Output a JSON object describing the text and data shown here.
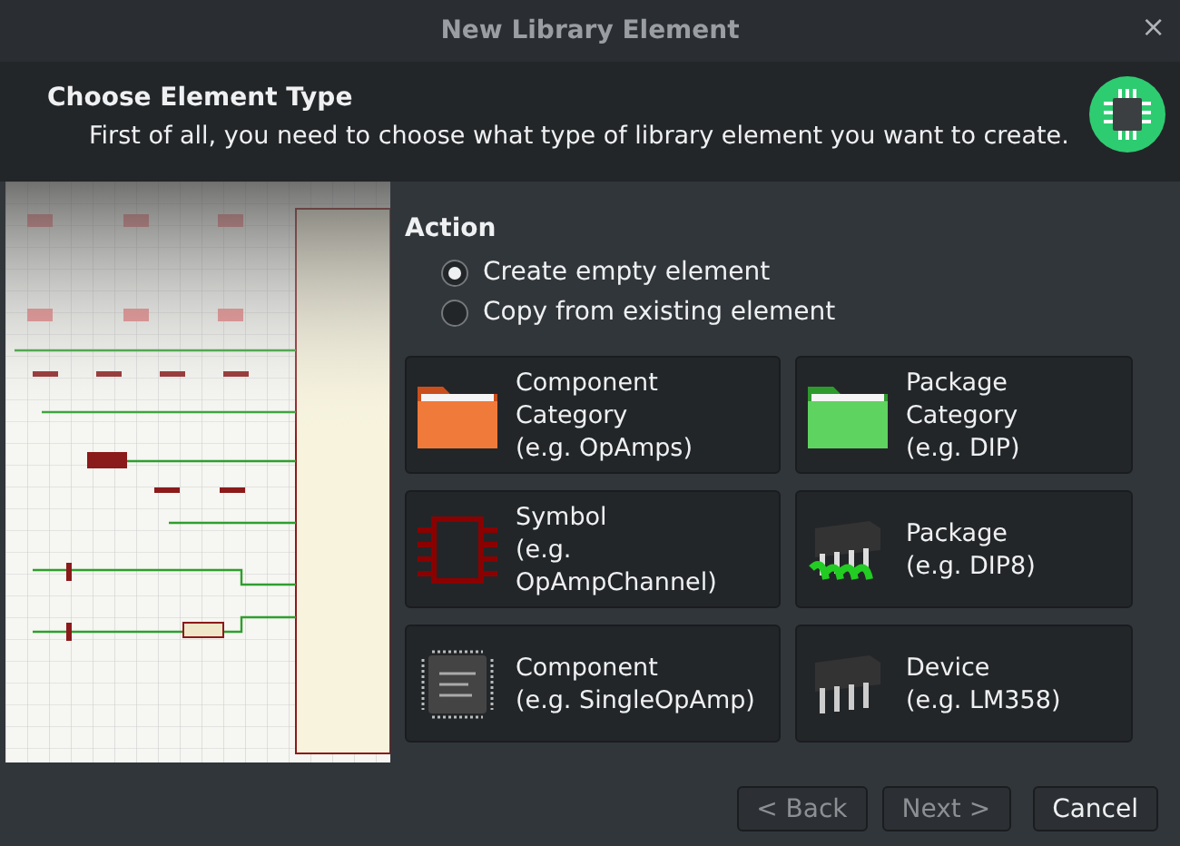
{
  "window": {
    "title": "New Library Element",
    "close": "×"
  },
  "header": {
    "title": "Choose Element Type",
    "subtitle": "First of all, you need to choose what type of library element you want to create."
  },
  "action": {
    "label": "Action",
    "options": [
      {
        "label": "Create empty element",
        "selected": true
      },
      {
        "label": "Copy from existing element",
        "selected": false
      }
    ]
  },
  "element_types": [
    {
      "kind": "component-category",
      "title": "Component Category",
      "example": "(e.g. OpAmps)"
    },
    {
      "kind": "package-category",
      "title": "Package Category",
      "example": "(e.g. DIP)"
    },
    {
      "kind": "symbol",
      "title": "Symbol",
      "example": "(e.g. OpAmpChannel)"
    },
    {
      "kind": "package",
      "title": "Package",
      "example": "(e.g. DIP8)"
    },
    {
      "kind": "component",
      "title": "Component",
      "example": "(e.g. SingleOpAmp)"
    },
    {
      "kind": "device",
      "title": "Device",
      "example": "(e.g. LM358)"
    }
  ],
  "buttons": [
    {
      "label": "< Back",
      "disabled": true
    },
    {
      "label": "Next >",
      "disabled": true
    },
    {
      "label": "Cancel",
      "disabled": false
    }
  ]
}
